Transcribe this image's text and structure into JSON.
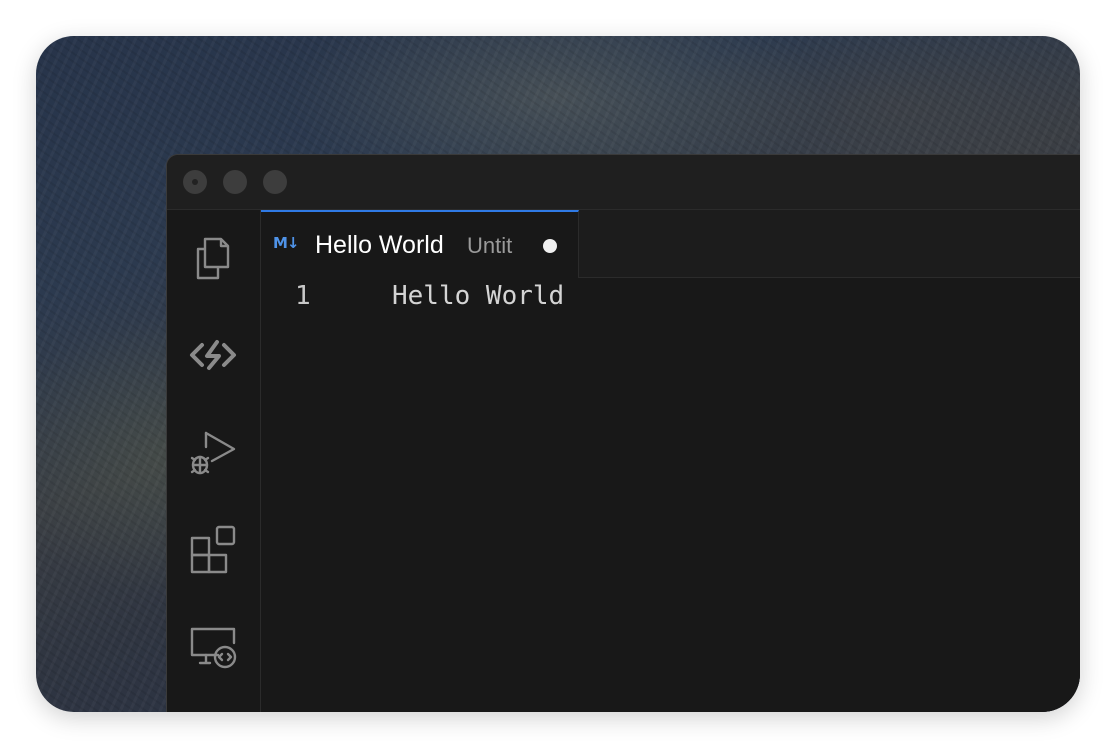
{
  "window": {
    "traffic_lights": [
      "close",
      "minimize",
      "zoom"
    ]
  },
  "activity_bar": {
    "items": [
      {
        "icon": "files-icon"
      },
      {
        "icon": "source-control-icon"
      },
      {
        "icon": "run-debug-icon"
      },
      {
        "icon": "extensions-icon"
      },
      {
        "icon": "remote-explorer-icon"
      }
    ]
  },
  "tab": {
    "icon": "markdown-icon",
    "icon_text": "M↓",
    "title": "Hello World",
    "description": "Untit",
    "dirty": true
  },
  "editor": {
    "lines": [
      {
        "number": "1",
        "text": "Hello World"
      }
    ]
  },
  "colors": {
    "accent": "#2f7ae5",
    "markdown_icon": "#4f93e8",
    "editor_bg": "#181818"
  }
}
